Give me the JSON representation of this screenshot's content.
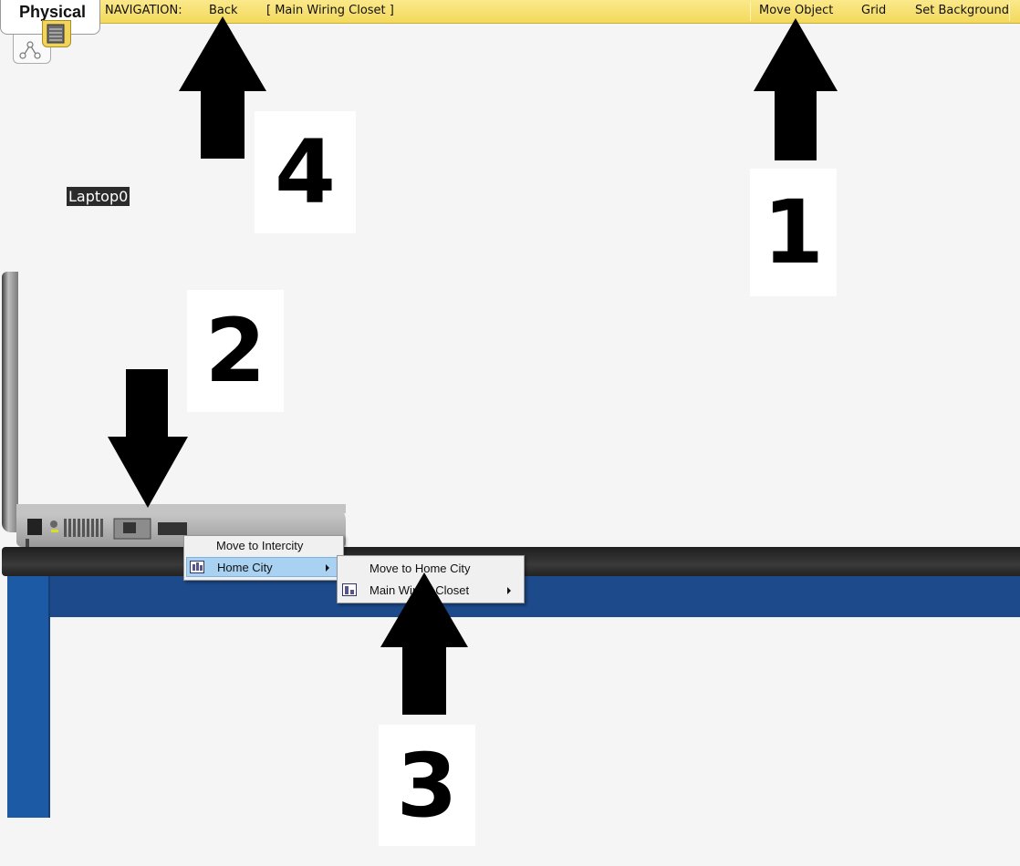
{
  "toolbar": {
    "tab_label": "Physical",
    "navigation_label": "NAVIGATION:",
    "back_label": "Back",
    "location_label": "[ Main Wiring Closet ]",
    "move_object_label": "Move Object",
    "grid_label": "Grid",
    "set_background_label": "Set Background"
  },
  "device": {
    "label": "Laptop0"
  },
  "annotations": {
    "n1": "1",
    "n2": "2",
    "n3": "3",
    "n4": "4"
  },
  "context_menu": {
    "items": [
      "Move to Intercity",
      "Home City"
    ]
  },
  "submenu": {
    "items": [
      "Move to Home City",
      "Main Wiring Closet"
    ]
  },
  "colors": {
    "toolbar": "#f3d95c",
    "table_blue": "#1c4a8a",
    "menu_highlight": "#a9d1f2"
  }
}
